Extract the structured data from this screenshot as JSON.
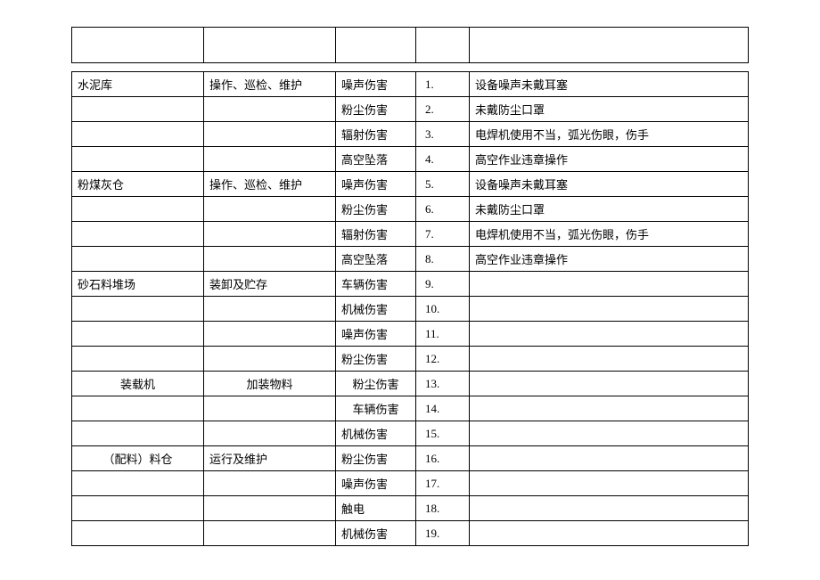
{
  "rows": [
    {
      "loc": "水泥库",
      "act": "操作、巡检、维护",
      "haz": "噪声伤害",
      "num": "1.",
      "desc": "设备噪声未戴耳塞"
    },
    {
      "loc": "",
      "act": "",
      "haz": "粉尘伤害",
      "num": "2.",
      "desc": "未戴防尘口罩"
    },
    {
      "loc": "",
      "act": "",
      "haz": "辐射伤害",
      "num": "3.",
      "desc": "电焊机使用不当，弧光伤眼，伤手"
    },
    {
      "loc": "",
      "act": "",
      "haz": "高空坠落",
      "num": "4.",
      "desc": "高空作业违章操作"
    },
    {
      "loc": "粉煤灰仓",
      "act": "操作、巡检、维护",
      "haz": "噪声伤害",
      "num": "5.",
      "desc": "设备噪声未戴耳塞"
    },
    {
      "loc": "",
      "act": "",
      "haz": "粉尘伤害",
      "num": "6.",
      "desc": "未戴防尘口罩"
    },
    {
      "loc": "",
      "act": "",
      "haz": "辐射伤害",
      "num": "7.",
      "desc": "电焊机使用不当，弧光伤眼，伤手"
    },
    {
      "loc": "",
      "act": "",
      "haz": "高空坠落",
      "num": "8.",
      "desc": "高空作业违章操作"
    },
    {
      "loc": "砂石料堆场",
      "act": "装卸及贮存",
      "haz": "车辆伤害",
      "num": "9.",
      "desc": ""
    },
    {
      "loc": "",
      "act": "",
      "haz": "机械伤害",
      "num": "10.",
      "desc": ""
    },
    {
      "loc": "",
      "act": "",
      "haz": "噪声伤害",
      "num": "11.",
      "desc": ""
    },
    {
      "loc": "",
      "act": "",
      "haz": "粉尘伤害",
      "num": "12.",
      "desc": ""
    },
    {
      "loc": "装载机",
      "locClass": "center",
      "act": "加装物料",
      "actClass": "center",
      "haz": "粉尘伤害",
      "hazClass": "center",
      "num": "13.",
      "desc": ""
    },
    {
      "loc": "",
      "act": "",
      "haz": "车辆伤害",
      "hazClass": "center",
      "num": "14.",
      "desc": ""
    },
    {
      "loc": "",
      "act": "",
      "haz": "机械伤害",
      "num": "15.",
      "desc": ""
    },
    {
      "loc": "（配料）料仓",
      "locClass": "center",
      "act": "运行及维护",
      "haz": "粉尘伤害",
      "num": "16.",
      "desc": ""
    },
    {
      "loc": "",
      "act": "",
      "haz": "噪声伤害",
      "num": "17.",
      "desc": ""
    },
    {
      "loc": "",
      "act": "",
      "haz": "触电",
      "num": "18.",
      "desc": ""
    },
    {
      "loc": "",
      "act": "",
      "haz": "机械伤害",
      "num": "19.",
      "desc": ""
    }
  ]
}
